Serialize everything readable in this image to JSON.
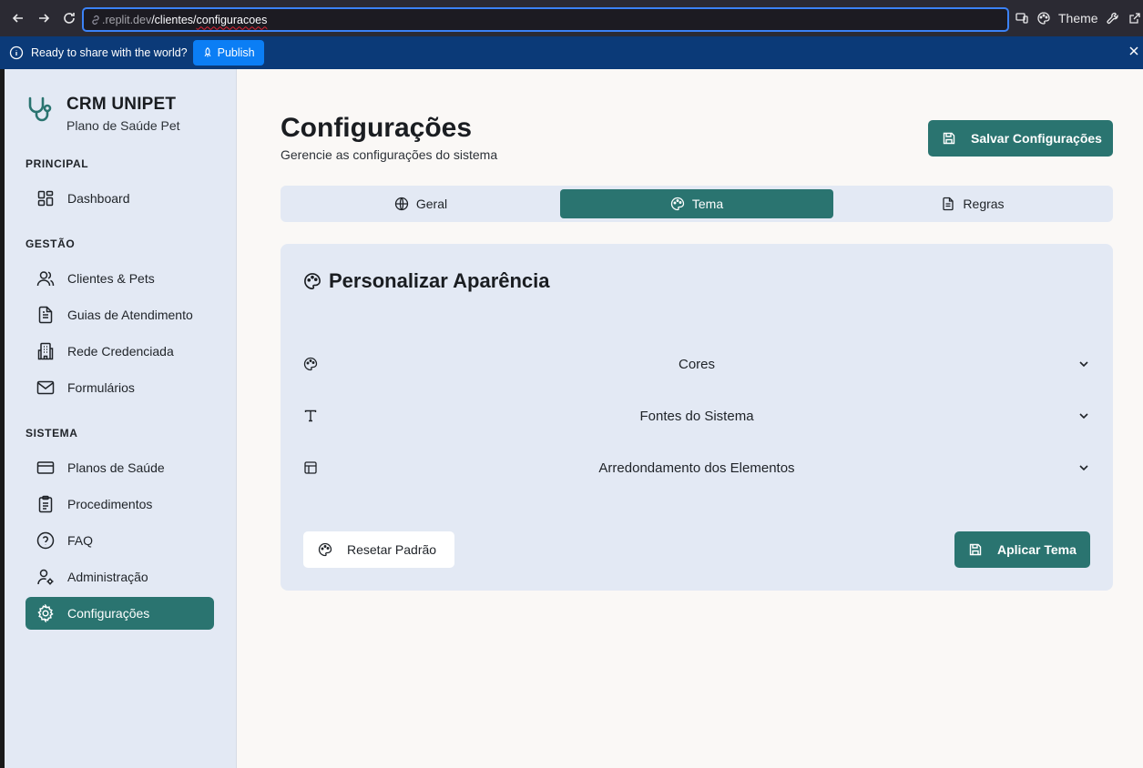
{
  "browser": {
    "url_host": ".replit.dev",
    "url_path_a": "/clientes/",
    "url_path_b": "configuracoes",
    "theme_label": "Theme"
  },
  "banner": {
    "message": "Ready to share with the world?",
    "publish_label": "Publish"
  },
  "sidebar": {
    "brand_title": "CRM UNIPET",
    "brand_subtitle": "Plano de Saúde Pet",
    "sections": [
      "PRINCIPAL",
      "GESTÃO",
      "SISTEMA"
    ],
    "items": [
      {
        "label": "Dashboard",
        "icon": "dashboard-icon"
      },
      {
        "label": "Clientes & Pets",
        "icon": "users-icon"
      },
      {
        "label": "Guias de Atendimento",
        "icon": "file-text-icon"
      },
      {
        "label": "Rede Credenciada",
        "icon": "building-icon"
      },
      {
        "label": "Formulários",
        "icon": "mail-icon"
      },
      {
        "label": "Planos de Saúde",
        "icon": "credit-card-icon"
      },
      {
        "label": "Procedimentos",
        "icon": "clipboard-icon"
      },
      {
        "label": "FAQ",
        "icon": "help-circle-icon"
      },
      {
        "label": "Administração",
        "icon": "user-cog-icon"
      },
      {
        "label": "Configurações",
        "icon": "settings-icon",
        "active": true
      }
    ]
  },
  "main": {
    "title": "Configurações",
    "subtitle": "Gerencie as configurações do sistema",
    "save_label": "Salvar Configurações",
    "tabs": [
      {
        "label": "Geral",
        "icon": "globe-icon"
      },
      {
        "label": "Tema",
        "icon": "palette-icon",
        "active": true
      },
      {
        "label": "Regras",
        "icon": "file-text-icon"
      }
    ],
    "card": {
      "title": "Personalizar Aparência",
      "sections": [
        {
          "label": "Cores",
          "icon": "palette-icon"
        },
        {
          "label": "Fontes do Sistema",
          "icon": "type-icon"
        },
        {
          "label": "Arredondamento dos Elementos",
          "icon": "layout-icon"
        }
      ],
      "reset_label": "Resetar Padrão",
      "apply_label": "Aplicar Tema"
    }
  },
  "colors": {
    "accent": "#2a7470",
    "sidebar_bg": "#e3e9f4",
    "banner_bg": "#0b3a78",
    "publish_bg": "#0b7ef5"
  }
}
